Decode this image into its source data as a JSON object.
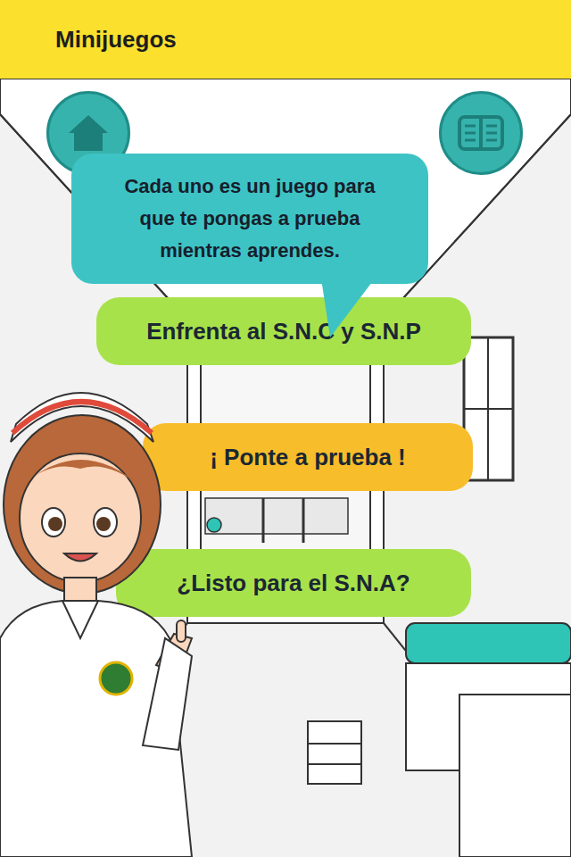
{
  "header": {
    "title": "Minijuegos"
  },
  "bubble": {
    "lines": [
      "Cada uno es un juego para",
      "que te pongas a prueba",
      "mientras aprendes."
    ]
  },
  "games": [
    {
      "label": "Enfrenta al S.N.C y S.N.P",
      "color": "#a8e24b"
    },
    {
      "label": "¡ Ponte a prueba !",
      "color": "#f8bd2a"
    },
    {
      "label": "¿Listo para el S.N.A?",
      "color": "#a8e24b"
    }
  ]
}
